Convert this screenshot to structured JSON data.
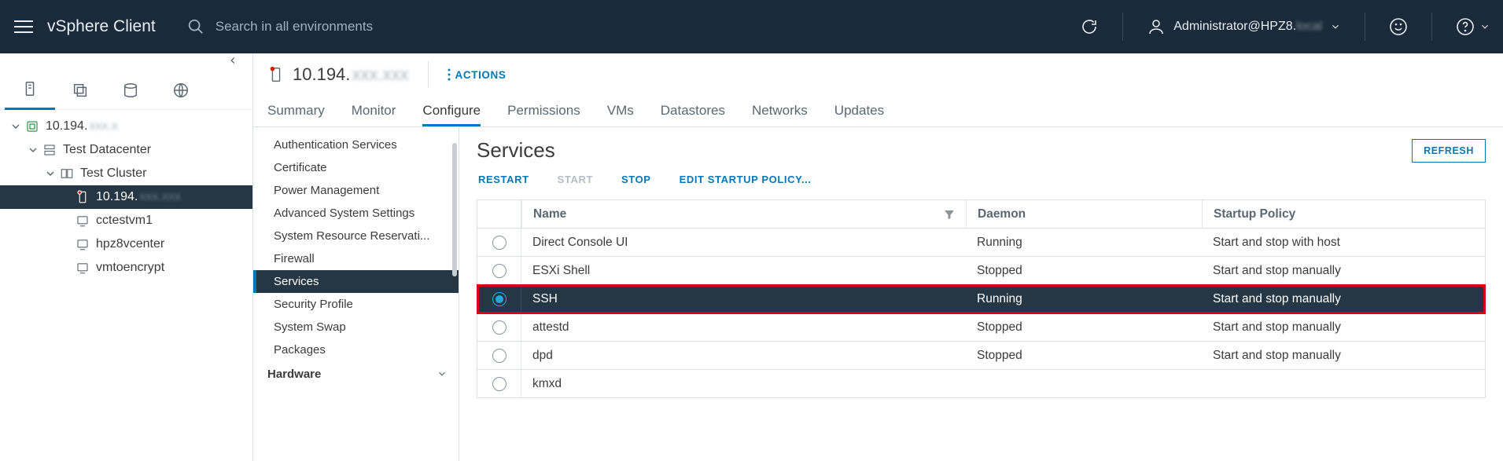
{
  "topbar": {
    "brand": "vSphere Client",
    "search_placeholder": "Search in all environments",
    "user_label": "Administrator@HPZ8.",
    "user_blur": "local"
  },
  "tree": {
    "root": "10.194.",
    "root_blur": "xxx.x",
    "dc": "Test Datacenter",
    "cluster": "Test Cluster",
    "host": "10.194.",
    "host_blur": "xxx.xxx",
    "vm1": "cctestvm1",
    "vm2": "hpz8vcenter",
    "vm3": "vmtoencrypt"
  },
  "object": {
    "title": "10.194.",
    "title_blur": "xxx.xxx",
    "actions_label": "ACTIONS"
  },
  "tabs": {
    "summary": "Summary",
    "monitor": "Monitor",
    "configure": "Configure",
    "permissions": "Permissions",
    "vms": "VMs",
    "datastores": "Datastores",
    "networks": "Networks",
    "updates": "Updates"
  },
  "cfg": {
    "auth": "Authentication Services",
    "cert": "Certificate",
    "power": "Power Management",
    "adv": "Advanced System Settings",
    "sysres": "System Resource Reservati...",
    "firewall": "Firewall",
    "services": "Services",
    "secprof": "Security Profile",
    "swap": "System Swap",
    "packages": "Packages",
    "hardware": "Hardware"
  },
  "services": {
    "title": "Services",
    "refresh": "REFRESH",
    "restart": "RESTART",
    "start": "START",
    "stop": "STOP",
    "editpolicy": "EDIT STARTUP POLICY...",
    "col_name": "Name",
    "col_daemon": "Daemon",
    "col_policy": "Startup Policy",
    "rows": [
      {
        "name": "Direct Console UI",
        "daemon": "Running",
        "policy": "Start and stop with host",
        "selected": false
      },
      {
        "name": "ESXi Shell",
        "daemon": "Stopped",
        "policy": "Start and stop manually",
        "selected": false
      },
      {
        "name": "SSH",
        "daemon": "Running",
        "policy": "Start and stop manually",
        "selected": true,
        "highlight": true
      },
      {
        "name": "attestd",
        "daemon": "Stopped",
        "policy": "Start and stop manually",
        "selected": false
      },
      {
        "name": "dpd",
        "daemon": "Stopped",
        "policy": "Start and stop manually",
        "selected": false
      },
      {
        "name": "kmxd",
        "daemon": "",
        "policy": "",
        "selected": false
      }
    ]
  }
}
